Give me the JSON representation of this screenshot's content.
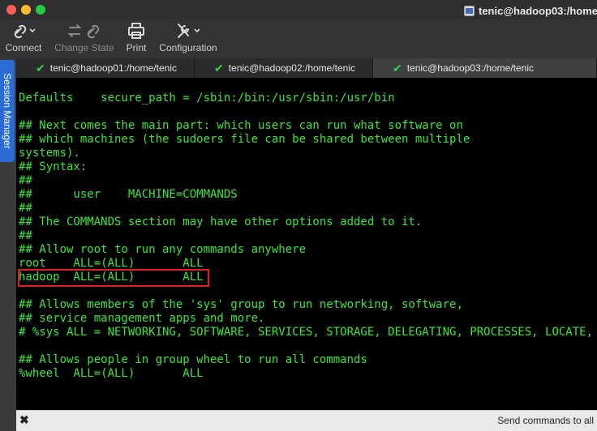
{
  "window": {
    "title": "tenic@hadoop03:/home"
  },
  "toolbar": {
    "connect_label": "Connect",
    "change_state_label": "Change State",
    "print_label": "Print",
    "configuration_label": "Configuration"
  },
  "side_panel": {
    "label": "Session Manager"
  },
  "tabs": [
    {
      "label": "tenic@hadoop01:/home/tenic"
    },
    {
      "label": "tenic@hadoop02:/home/tenic"
    },
    {
      "label": "tenic@hadoop03:/home/tenic"
    }
  ],
  "terminal": {
    "lines": [
      "",
      "Defaults    secure_path = /sbin:/bin:/usr/sbin:/usr/bin",
      "",
      "## Next comes the main part: which users can run what software on",
      "## which machines (the sudoers file can be shared between multiple",
      "systems).",
      "## Syntax:",
      "##",
      "##      user    MACHINE=COMMANDS",
      "##",
      "## The COMMANDS section may have other options added to it.",
      "##",
      "## Allow root to run any commands anywhere",
      "root    ALL=(ALL)       ALL",
      "hadoop  ALL=(ALL)       ALL",
      "",
      "## Allows members of the 'sys' group to run networking, software,",
      "## service management apps and more.",
      "# %sys ALL = NETWORKING, SOFTWARE, SERVICES, STORAGE, DELEGATING, PROCESSES, LOCATE, DRIVERS",
      "",
      "## Allows people in group wheel to run all commands",
      "%wheel  ALL=(ALL)       ALL"
    ]
  },
  "bottom_bar": {
    "close_symbol": "✖",
    "send_label": "Send commands to all"
  },
  "colors": {
    "terminal_text": "#39e639",
    "terminal_bg": "#000000",
    "highlight_box": "#e02020",
    "side_tab": "#2a6bd6"
  }
}
